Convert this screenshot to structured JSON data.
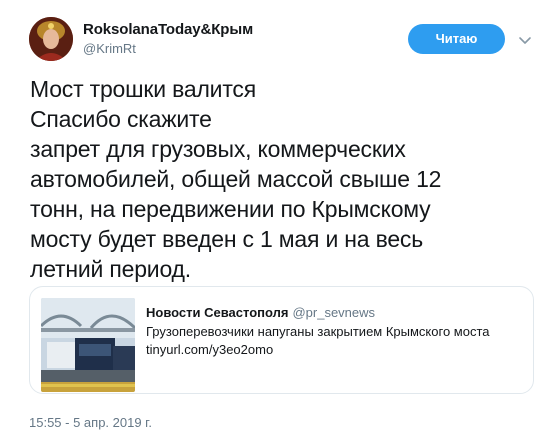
{
  "author": {
    "name": "RoksolanaToday&Крым",
    "handle": "@KrimRt",
    "follow_label": "Читаю"
  },
  "tweet": {
    "lines": [
      "Мост трошки валится",
      "Спасибо скажите",
      "запрет для грузовых, коммерческих",
      "автомобилей, общей массой свыше 12",
      "тонн, на передвижении по Крымскому",
      "мосту будет введен с 1 мая и на весь",
      "летний период."
    ],
    "timestamp": "15:55 - 5 апр. 2019 г."
  },
  "card": {
    "source": "Новости Севастополя",
    "handle": "@pr_sevnews",
    "description": "Грузоперевозчики напуганы закрытием Крымского моста",
    "url": "tinyurl.com/y3eo2omo"
  },
  "colors": {
    "follow_button": "#2e9df0",
    "secondary_text": "#657786",
    "card_border": "#e1e8ed"
  },
  "icons": {
    "menu": "chevron-down-icon"
  }
}
